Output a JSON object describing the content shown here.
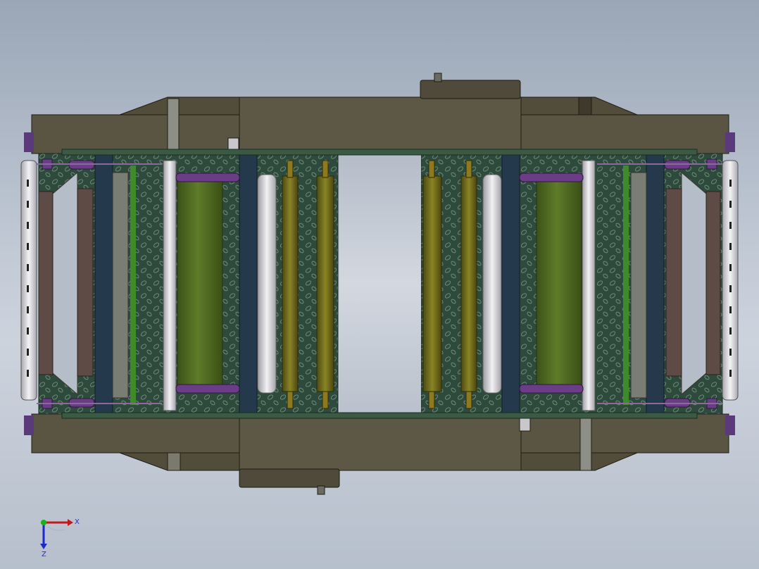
{
  "window": {
    "title": ""
  },
  "colors": {
    "background_top": "#9aa6b6",
    "background_bottom": "#cdd3dd",
    "housing": "#5a5443",
    "housing_dark": "#48432f",
    "frame_blue": "#243a4c",
    "mesh_green": "#2e4a3c",
    "roller_green": "#4f6a22",
    "roller_olive": "#6f6a1c",
    "roller_white": "#d8d8dc",
    "purple": "#6a3d86",
    "end_roller": "#e4e4e8"
  },
  "icons": {
    "axis_triad": "coordinate-triad-icon"
  },
  "triad": {
    "x_label": "X",
    "z_label": "Z"
  }
}
